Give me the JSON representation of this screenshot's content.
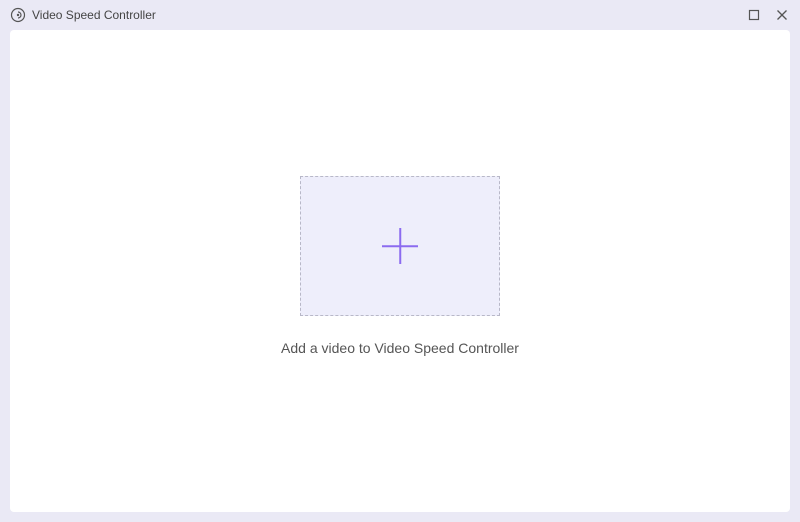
{
  "titlebar": {
    "title": "Video Speed Controller"
  },
  "main": {
    "instruction": "Add a video to Video Speed Controller"
  }
}
